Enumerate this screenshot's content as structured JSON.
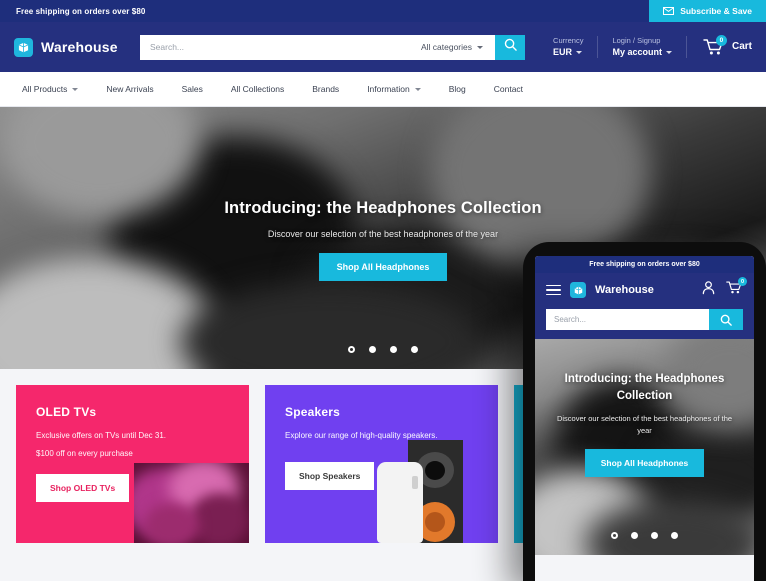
{
  "colors": {
    "navy_dark": "#1e2e7c",
    "navy": "#25307f",
    "cyan": "#18b9dd",
    "pink": "#f5276c",
    "purple": "#7040f0",
    "page_bg": "#f4f5f8"
  },
  "topbar": {
    "message": "Free shipping on orders over $80",
    "subscribe_label": "Subscribe & Save",
    "subscribe_icon": "envelope-icon"
  },
  "header": {
    "brand_name": "Warehouse",
    "brand_icon": "package-box-icon",
    "search": {
      "placeholder": "Search...",
      "value": "",
      "category_label": "All categories",
      "search_icon": "search-icon"
    },
    "currency": {
      "label": "Currency",
      "value": "EUR"
    },
    "account": {
      "label": "Login / Signup",
      "value": "My account"
    },
    "cart": {
      "label": "Cart",
      "count": "0",
      "icon": "shopping-cart-icon"
    }
  },
  "nav": {
    "items": [
      {
        "label": "All Products",
        "has_dropdown": true
      },
      {
        "label": "New Arrivals",
        "has_dropdown": false
      },
      {
        "label": "Sales",
        "has_dropdown": false
      },
      {
        "label": "All Collections",
        "has_dropdown": false
      },
      {
        "label": "Brands",
        "has_dropdown": false
      },
      {
        "label": "Information",
        "has_dropdown": true
      },
      {
        "label": "Blog",
        "has_dropdown": false
      },
      {
        "label": "Contact",
        "has_dropdown": false
      }
    ]
  },
  "hero": {
    "title": "Introducing: the Headphones Collection",
    "subtitle": "Discover our selection of the best headphones of the year",
    "cta_label": "Shop All Headphones",
    "slide_count": 4,
    "active_slide": 1
  },
  "promos": [
    {
      "title": "OLED TVs",
      "line1": "Exclusive offers on TVs until Dec 31.",
      "line2": "$100 off on every purchase",
      "button": "Shop OLED TVs",
      "bg": "#f5276c",
      "text_color": "#ffffff",
      "button_text_color": "#e8225f"
    },
    {
      "title": "Speakers",
      "line1": "Explore our range of high-quality speakers.",
      "line2": "",
      "button": "Shop Speakers",
      "bg": "#7040f0",
      "text_color": "#ffffff",
      "button_text_color": "#3a3a3a"
    },
    {
      "title": "",
      "line1": "",
      "line2": "",
      "button": "",
      "bg": "#18b9dd",
      "text_color": "#ffffff",
      "button_text_color": "#18b9dd"
    }
  ],
  "phone": {
    "topbar_message": "Free shipping on orders over $80",
    "brand_name": "Warehouse",
    "brand_icon": "package-box-icon",
    "menu_icon": "hamburger-menu-icon",
    "account_icon": "user-account-icon",
    "cart_icon": "shopping-cart-icon",
    "cart_count": "0",
    "search_placeholder": "Search...",
    "search_icon": "search-icon",
    "hero_title": "Introducing: the Headphones Collection",
    "hero_subtitle": "Discover our selection of the best headphones of the year",
    "hero_cta": "Shop All Headphones",
    "slide_count": 4,
    "active_slide": 1
  }
}
